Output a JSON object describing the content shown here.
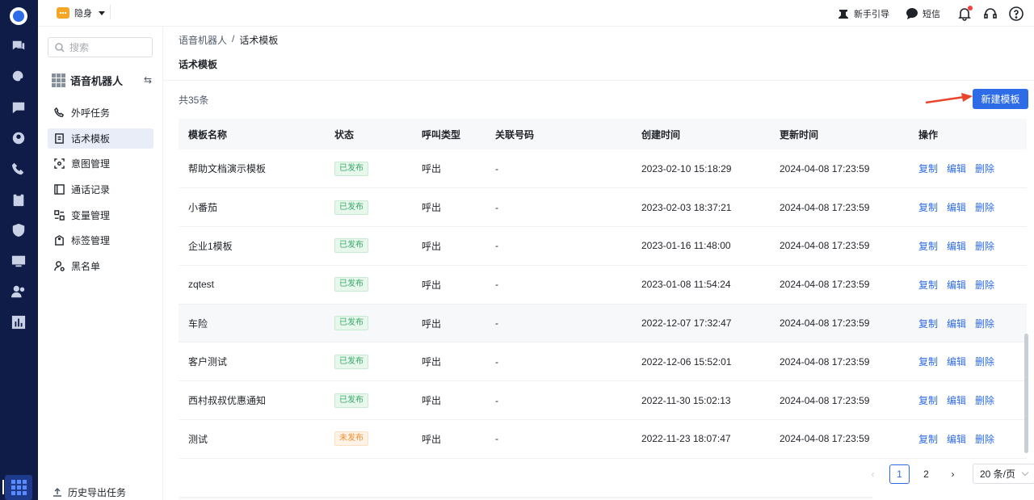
{
  "header": {
    "status_label": "隐身",
    "links": [
      {
        "label": "新手引导",
        "icon": "guide-icon"
      },
      {
        "label": "短信",
        "icon": "sms-icon"
      }
    ],
    "icons": [
      "bell-icon",
      "headset-icon",
      "help-icon"
    ]
  },
  "rail": {
    "icons": [
      "chat-icon",
      "support-icon",
      "message-icon",
      "contact-icon",
      "phone-icon",
      "clipboard-icon",
      "shield-icon",
      "monitor-icon",
      "users-icon",
      "chart-icon"
    ],
    "bottom_icon": "apps-grid-icon"
  },
  "sidebar": {
    "search_placeholder": "搜索",
    "module_title": "语音机器人",
    "items": [
      {
        "label": "外呼任务",
        "icon": "phone-outbound-icon"
      },
      {
        "label": "话术模板",
        "icon": "document-icon",
        "active": true
      },
      {
        "label": "意图管理",
        "icon": "scan-icon"
      },
      {
        "label": "通话记录",
        "icon": "record-icon"
      },
      {
        "label": "变量管理",
        "icon": "variable-icon"
      },
      {
        "label": "标签管理",
        "icon": "tag-icon"
      },
      {
        "label": "黑名单",
        "icon": "user-block-icon"
      }
    ],
    "export_label": "历史导出任务"
  },
  "main": {
    "breadcrumb": [
      "语音机器人",
      "/",
      "话术模板"
    ],
    "title": "话术模板",
    "count": "共35条",
    "new_button": "新建模板",
    "columns": [
      "模板名称",
      "状态",
      "呼叫类型",
      "关联号码",
      "创建时间",
      "更新时间",
      "操作"
    ],
    "ops": [
      "复制",
      "编辑",
      "删除"
    ],
    "rows": [
      {
        "name": "帮助文档演示模板",
        "status": "已发布",
        "published": true,
        "call_type": "呼出",
        "number": "-",
        "created": "2023-02-10 15:18:29",
        "updated": "2024-04-08 17:23:59"
      },
      {
        "name": "小番茄",
        "status": "已发布",
        "published": true,
        "call_type": "呼出",
        "number": "-",
        "created": "2023-02-03 18:37:21",
        "updated": "2024-04-08 17:23:59"
      },
      {
        "name": "企业1模板",
        "status": "已发布",
        "published": true,
        "call_type": "呼出",
        "number": "-",
        "created": "2023-01-16 11:48:00",
        "updated": "2024-04-08 17:23:59"
      },
      {
        "name": "zqtest",
        "status": "已发布",
        "published": true,
        "call_type": "呼出",
        "number": "-",
        "created": "2023-01-08 11:54:24",
        "updated": "2024-04-08 17:23:59"
      },
      {
        "name": "车险",
        "status": "已发布",
        "published": true,
        "call_type": "呼出",
        "number": "-",
        "created": "2022-12-07 17:32:47",
        "updated": "2024-04-08 17:23:59",
        "highlight": true
      },
      {
        "name": "客户测试",
        "status": "已发布",
        "published": true,
        "call_type": "呼出",
        "number": "-",
        "created": "2022-12-06 15:52:01",
        "updated": "2024-04-08 17:23:59"
      },
      {
        "name": "西村叔叔优惠通知",
        "status": "已发布",
        "published": true,
        "call_type": "呼出",
        "number": "-",
        "created": "2022-11-30 15:02:13",
        "updated": "2024-04-08 17:23:59"
      },
      {
        "name": "测试",
        "status": "未发布",
        "published": false,
        "call_type": "呼出",
        "number": "-",
        "created": "2022-11-23 18:07:47",
        "updated": "2024-04-08 17:23:59"
      }
    ],
    "pagination": {
      "pages": [
        "1",
        "2"
      ],
      "current": "1",
      "page_size": "20 条/页"
    }
  },
  "colors": {
    "accent": "#2e6be6",
    "rail": "#0f1c47",
    "published": "#3aa767",
    "unpublished": "#f08c2d",
    "annotation_arrow": "#e8452c"
  }
}
